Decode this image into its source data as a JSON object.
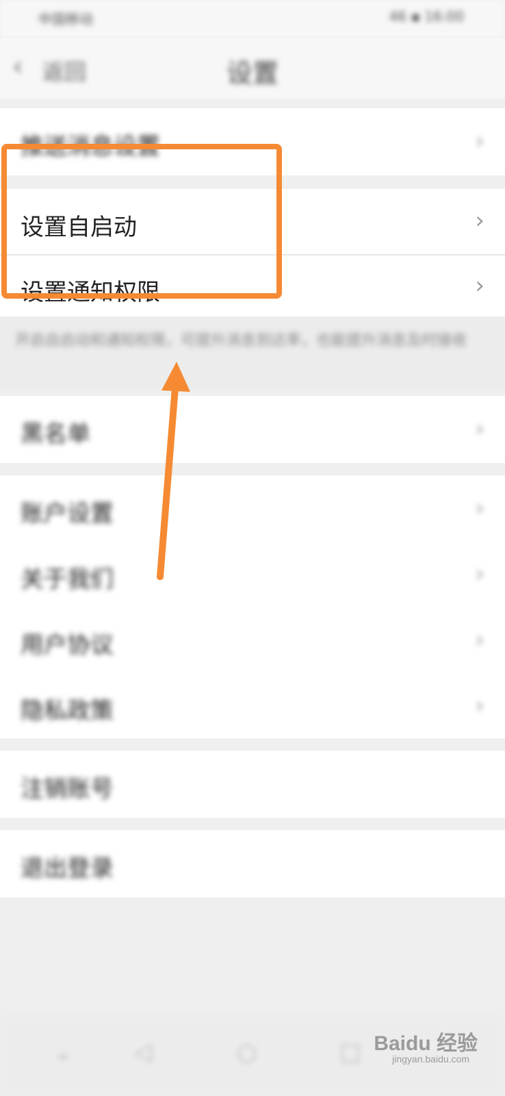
{
  "status_bar": {
    "left_text": "中国移动",
    "right_text": "46 ▪ 16:00"
  },
  "header": {
    "back_label": "返回",
    "title": "设置"
  },
  "rows": [
    {
      "label": "推送消息设置"
    },
    {
      "label": "设置自启动"
    },
    {
      "label": "设置通知权限"
    },
    {
      "label": "黑名单"
    },
    {
      "label": "账户设置"
    },
    {
      "label": "关于我们"
    },
    {
      "label": "用户协议"
    },
    {
      "label": "隐私政策"
    },
    {
      "label": "注销账号"
    },
    {
      "label": "退出登录"
    }
  ],
  "note": {
    "text": "开启自启动和通知权限，可提升消息到达率，也能提升消息及时接收"
  },
  "navbar": {
    "icons": [
      "chevron-down-icon",
      "back-icon",
      "home-icon",
      "recents-icon"
    ]
  },
  "watermark": {
    "logo": "Baidu 经验",
    "sub": "jingyan.baidu.com"
  },
  "colors": {
    "highlight": "#f58a33",
    "arrow": "#f58a33"
  }
}
